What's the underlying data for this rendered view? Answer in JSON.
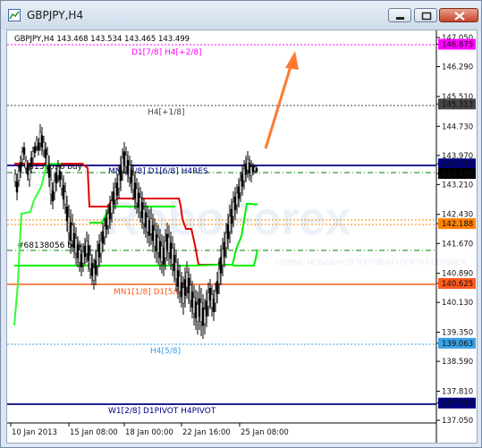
{
  "window": {
    "title": "GBPJPY,H4",
    "buttons": {
      "minimize": "minimize-icon",
      "restore": "restore-icon",
      "close": "close-icon"
    }
  },
  "chart_info": "GBPJPY,H4  143.468 143.534 143.465 143.499",
  "watermark": "RoboForex",
  "watermark_sub": "СЕРВИС МОБИЛЬНОЙ ТОРГОВЛИ • ПОРТАЛ СЕРВИСА",
  "colors": {
    "background": "#ffffff",
    "candles": "#000000",
    "bid_line": "#000080",
    "ask_line": "#ff8000",
    "red_channel": "#e00000",
    "green_channel": "#00ee00",
    "murrey_pink": "#ff00ff",
    "murrey_gray": "#444444",
    "murrey_orange": "#ff5a1f",
    "murrey_blue": "#3aa0e6",
    "murrey_navy": "#000080",
    "dash_green": "#008000",
    "arrow": "#ff7a30"
  },
  "levels": [
    {
      "label": "D1[7/8] H4[+2/8]",
      "price": "146.875",
      "color": "#ff00ff"
    },
    {
      "label": "H4[+1/8]",
      "price": "145.313",
      "color": "#444444"
    },
    {
      "label": "MN1[8/8] D1[6/8] H4RES",
      "price": "143.750",
      "color": "#000080"
    },
    {
      "label": "",
      "price": "142.188",
      "color": "#ff8000"
    },
    {
      "label": "MN1[1/8] D1[5/8]",
      "price": "140.625",
      "color": "#ff5a1f"
    },
    {
      "label": "H4[5/8]",
      "price": "139.063",
      "color": "#3aa0e6"
    },
    {
      "label": "W1[2/8] D1PIVOT H4PIVOT",
      "price": "137.500",
      "color": "#000080"
    }
  ],
  "current_price": "143.499",
  "order_label": "#68138056 buy",
  "order_label_top": "#68138056 buy",
  "price_scale": [
    "147.050",
    "146.875",
    "146.290",
    "145.510",
    "145.313",
    "144.730",
    "143.970",
    "143.750",
    "143.499",
    "143.210",
    "142.430",
    "142.188",
    "141.670",
    "140.890",
    "140.625",
    "140.130",
    "139.350",
    "139.063",
    "138.590",
    "137.810",
    "137.500",
    "137.050"
  ],
  "time_scale": [
    "10 Jan 2013",
    "15 Jan 08:00",
    "18 Jan 00:00",
    "22 Jan 16:00",
    "25 Jan 08:00"
  ]
}
